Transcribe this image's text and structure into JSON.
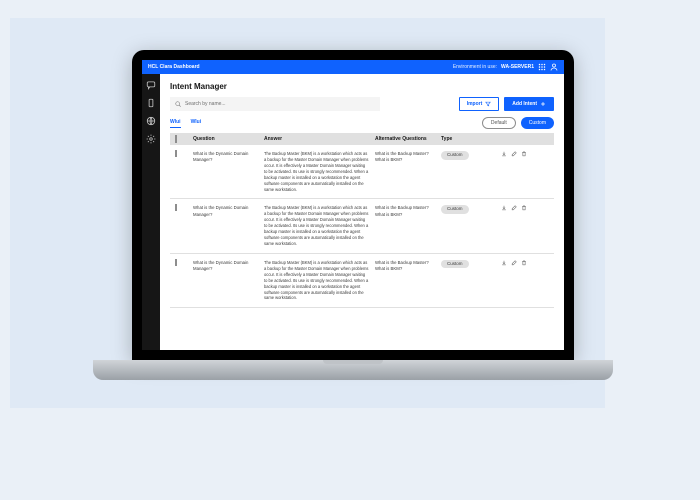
{
  "brand": "HCL Clara Dashboard",
  "env": {
    "label": "Environment in use:",
    "value": "WA-SERVER1"
  },
  "sidebar": {
    "items": [
      {
        "name": "intents",
        "icon": "chat"
      },
      {
        "name": "mobile",
        "icon": "device"
      },
      {
        "name": "network",
        "icon": "globe"
      },
      {
        "name": "settings",
        "icon": "gear"
      }
    ]
  },
  "page": {
    "title": "Intent Manager",
    "search_placeholder": "Search by name...",
    "buttons": {
      "import": "Import",
      "add": "Add Intent"
    },
    "tabs": [
      "Wlui",
      "Wlui"
    ],
    "active_tab": 0,
    "chips": {
      "default": "Default",
      "custom": "Custom"
    }
  },
  "table": {
    "columns": [
      "",
      "Question",
      "Answer",
      "Alternative Questions",
      "Type",
      ""
    ],
    "rows": [
      {
        "question": "What is the Dynamic Domain Manager?",
        "answer": "The Backup Master (BKM) is a workstation which acts as a backup for the Master Domain Manager when problems occur. It is effectively a Master Domain Manager waiting to be activated. Its use is strongly recommended. When a backup master is installed on a workstation the agent software components are automatically installed on the same workstation.",
        "alt": "What is the Backup Master? What is BKM?",
        "type": "Custom"
      },
      {
        "question": "What is the Dynamic Domain Manager?",
        "answer": "The Backup Master (BKM) is a workstation which acts as a backup for the Master Domain Manager when problems occur. It is effectively a Master Domain Manager waiting to be activated. Its use is strongly recommended. When a backup master is installed on a workstation the agent software components are automatically installed on the same workstation.",
        "alt": "What is the Backup Master? What is BKM?",
        "type": "Custom"
      },
      {
        "question": "What is the Dynamic Domain Manager?",
        "answer": "The Backup Master (BKM) is a workstation which acts as a backup for the Master Domain Manager when problems occur. It is effectively a Master Domain Manager waiting to be activated. Its use is strongly recommended. When a backup master is installed on a workstation the agent software components are automatically installed on the same workstation.",
        "alt": "What is the Backup Master? What is BKM?",
        "type": "Custom"
      }
    ]
  }
}
